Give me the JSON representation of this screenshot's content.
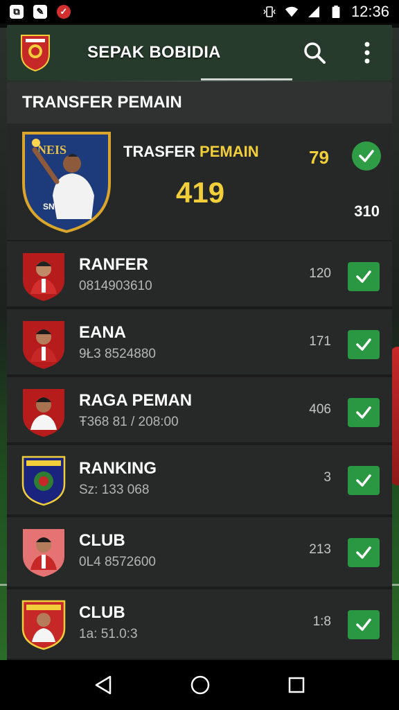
{
  "status_bar": {
    "time": "12:36",
    "left_icons": [
      "screenshot-icon",
      "gallery-icon",
      "app-notification-icon"
    ],
    "right_icons": [
      "vibrate-icon",
      "wifi-icon",
      "signal-icon",
      "battery-icon"
    ]
  },
  "app_bar": {
    "title": "SEPAK BOBIDIA",
    "icons": [
      "club-logo-icon",
      "search-icon",
      "more-vert-icon"
    ]
  },
  "section": {
    "title": "TRANSFER PEMAIN"
  },
  "featured": {
    "crest_text": "NEIS",
    "crest_sub": "SN",
    "title_white": "TRASFER",
    "title_yellow": "PEMAIN",
    "big_value": "419",
    "value": "79",
    "sub_value": "310"
  },
  "rows": [
    {
      "name": "RANFER",
      "sub": "0814903610",
      "value": "120"
    },
    {
      "name": "EANA",
      "sub": "9Ł3 8524880",
      "value": "171"
    },
    {
      "name": "RAGA PEMAN",
      "sub": "Ŧ368 81 / 208:00",
      "value": "406"
    },
    {
      "name": "RANKING",
      "sub": "Sz: 133 068",
      "value": "3"
    },
    {
      "name": "CLUB",
      "sub": "0L4 8572600",
      "value": "213"
    },
    {
      "name": "CLUB",
      "sub": "1a: 51.0:3",
      "value": "1:8"
    }
  ],
  "nav_bar": {
    "icons": [
      "back-icon",
      "home-icon",
      "recents-icon"
    ]
  },
  "colors": {
    "accent_green": "#2a9842",
    "highlight_yellow": "#f2cf3a",
    "app_bar": "#263b2b",
    "panel": "#2a2c2b"
  }
}
